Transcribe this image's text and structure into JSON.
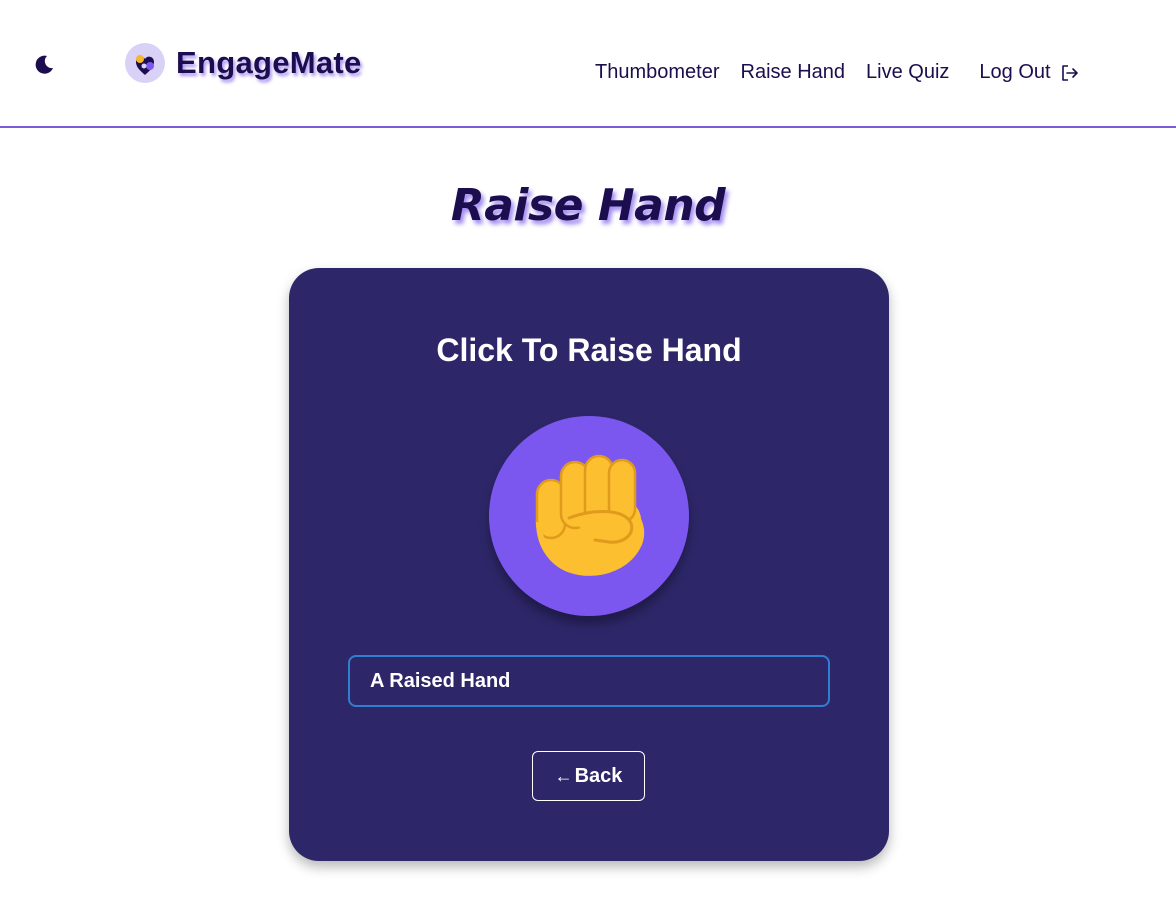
{
  "header": {
    "theme_icon": "moon-icon",
    "logo_icon": "engagemate-logo",
    "brand": "EngageMate",
    "nav": [
      {
        "label": "Thumbometer"
      },
      {
        "label": "Raise Hand"
      },
      {
        "label": "Live Quiz"
      }
    ],
    "logout_label": "Log Out",
    "logout_icon": "logout-icon"
  },
  "main": {
    "title": "Raise Hand",
    "card": {
      "heading": "Click To Raise Hand",
      "hand_icon": "raised-fist-icon",
      "input_value": "A Raised Hand",
      "back_label": "Back",
      "back_icon": "arrow-left-icon"
    }
  },
  "colors": {
    "brand_text": "#1b0d4e",
    "accent": "#7b57ef",
    "card_bg": "#2d2769",
    "input_border": "#2f7fd0",
    "fist": "#fbbf2f"
  }
}
